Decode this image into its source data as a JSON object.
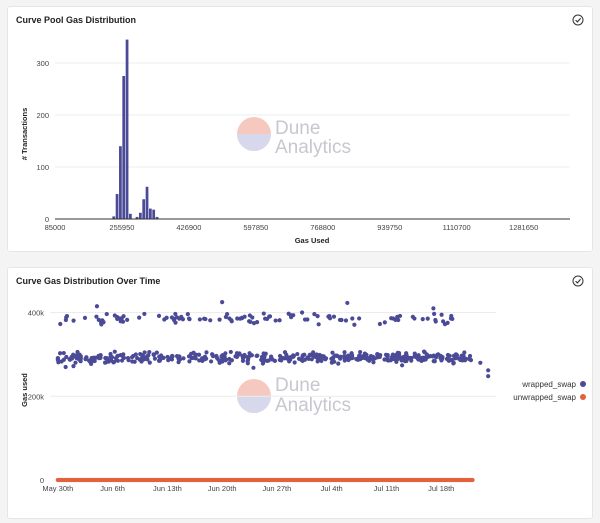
{
  "colors": {
    "wrapped": "#4b4a97",
    "unwrapped": "#e2623f",
    "bar": "#4b4a97"
  },
  "icons": {
    "panel_check": "check-circle-icon"
  },
  "watermark": {
    "line1": "Dune",
    "line2": "Analytics"
  },
  "charts": [
    {
      "title": "Curve Pool Gas Distribution",
      "chart_data": {
        "type": "bar",
        "title": "Curve Pool Gas Distribution",
        "xlabel": "Gas Used",
        "ylabel": "# Transactions",
        "xlim": [
          85000,
          1400000
        ],
        "ylim": [
          0,
          350
        ],
        "yticks": [
          0,
          100,
          200,
          300
        ],
        "xticks": [
          85000,
          255950,
          426900,
          597850,
          768800,
          939750,
          1110700,
          1281650
        ],
        "xtick_labels": [
          "85000",
          "255950",
          "426900",
          "597850",
          "768800",
          "939750",
          "1110700",
          "1281650"
        ],
        "bin_width": 8550,
        "bins": [
          {
            "x": 235000,
            "count": 5
          },
          {
            "x": 243500,
            "count": 48
          },
          {
            "x": 252000,
            "count": 140
          },
          {
            "x": 260500,
            "count": 275
          },
          {
            "x": 269000,
            "count": 345
          },
          {
            "x": 277500,
            "count": 10
          },
          {
            "x": 294500,
            "count": 4
          },
          {
            "x": 303000,
            "count": 12
          },
          {
            "x": 311500,
            "count": 38
          },
          {
            "x": 320000,
            "count": 62
          },
          {
            "x": 328500,
            "count": 20
          },
          {
            "x": 337000,
            "count": 18
          },
          {
            "x": 345500,
            "count": 4
          }
        ]
      }
    },
    {
      "title": "Curve Gas Distribution Over Time",
      "chart_data": {
        "type": "scatter",
        "title": "Curve Gas Distribution Over Time",
        "xlabel": "",
        "ylabel": "Gas used",
        "x_type": "date",
        "xlim": [
          "2021-05-29",
          "2021-07-25"
        ],
        "ylim": [
          0,
          430000
        ],
        "yticks": [
          0,
          200000,
          400000
        ],
        "ytick_labels": [
          "0",
          "200k",
          "400k"
        ],
        "xticks": [
          "2021-05-30",
          "2021-06-06",
          "2021-06-13",
          "2021-06-20",
          "2021-06-27",
          "2021-07-04",
          "2021-07-11",
          "2021-07-18"
        ],
        "xtick_labels": [
          "May 30th",
          "Jun 6th",
          "Jun 13th",
          "Jun 20th",
          "Jun 27th",
          "Jul 4th",
          "Jul 11th",
          "Jul 18th"
        ],
        "legend_position": "right",
        "series": [
          {
            "name": "wrapped_swap",
            "color": "#4b4a97",
            "clusters": [
              {
                "from": "2021-05-30",
                "to": "2021-07-22",
                "y_center": 292000,
                "y_spread": 12000,
                "count": 420
              },
              {
                "from": "2021-05-30",
                "to": "2021-07-20",
                "y_center": 385000,
                "y_spread": 14000,
                "count": 110
              }
            ],
            "points": [
              {
                "x": "2021-05-31",
                "y": 270000
              },
              {
                "x": "2021-06-01",
                "y": 272000
              },
              {
                "x": "2021-06-24",
                "y": 268000
              },
              {
                "x": "2021-07-13",
                "y": 274000
              },
              {
                "x": "2021-07-23",
                "y": 280000
              },
              {
                "x": "2021-07-24",
                "y": 248000
              },
              {
                "x": "2021-07-24",
                "y": 262000
              },
              {
                "x": "2021-06-20",
                "y": 425000
              },
              {
                "x": "2021-07-06",
                "y": 423000
              },
              {
                "x": "2021-06-04",
                "y": 415000
              },
              {
                "x": "2021-07-17",
                "y": 410000
              }
            ]
          },
          {
            "name": "unwrapped_swap",
            "color": "#e2623f",
            "range": {
              "from": "2021-05-30",
              "to": "2021-07-22",
              "y": 0,
              "count": 240
            }
          }
        ]
      }
    }
  ]
}
